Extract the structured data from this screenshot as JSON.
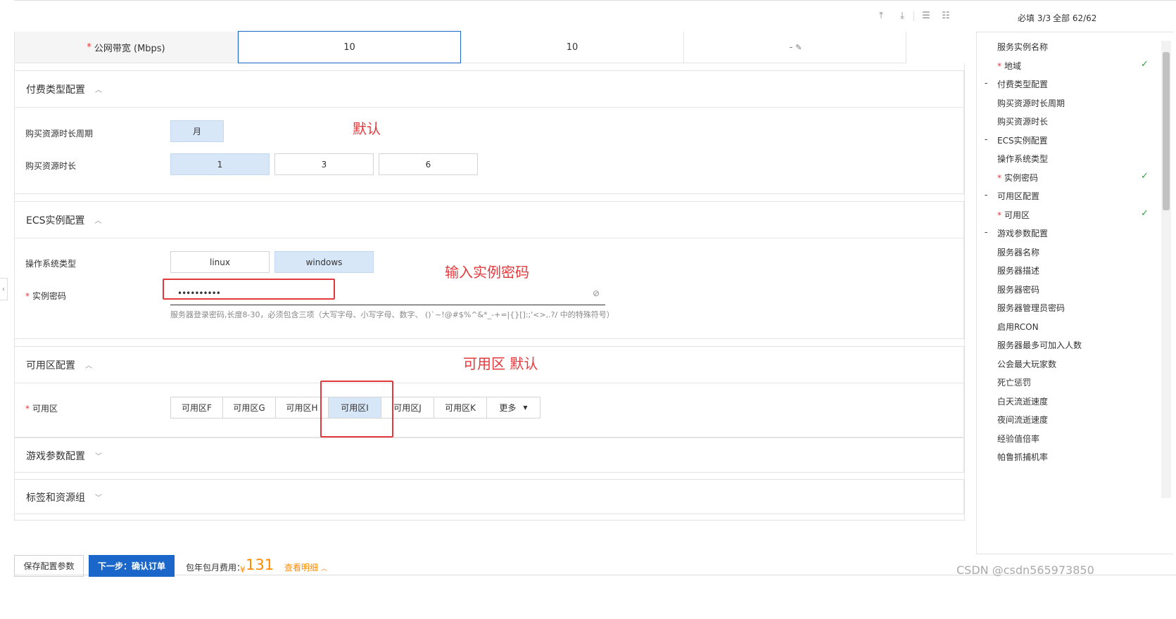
{
  "toolbar": {
    "required_count": "必填 3/3",
    "total_count": "全部 62/62"
  },
  "bandwidth": {
    "label": "公网带宽 (Mbps)",
    "input_value": "10",
    "col2": "10",
    "col3": "-"
  },
  "billing": {
    "title": "付费类型配置",
    "period_label": "购买资源时长周期",
    "period_options": [
      "月"
    ],
    "duration_label": "购买资源时长",
    "duration_options": [
      "1",
      "3",
      "6"
    ]
  },
  "ecs": {
    "title": "ECS实例配置",
    "os_label": "操作系统类型",
    "os_options": [
      "linux",
      "windows"
    ],
    "password_label": "实例密码",
    "password_value": "••••••••••",
    "password_hint": "服务器登录密码,长度8-30，必须包含三项（大写字母、小写字母、数字、 ()`~!@#$%^&*_-+=|{}[]:;'<>,.?/ 中的特殊符号）"
  },
  "zone": {
    "title": "可用区配置",
    "label": "可用区",
    "options": [
      "可用区F",
      "可用区G",
      "可用区H",
      "可用区I",
      "可用区J",
      "可用区K",
      "更多"
    ]
  },
  "collapsed_sections": [
    "游戏参数配置",
    "标签和资源组"
  ],
  "annotations": {
    "default": "默认",
    "password": "输入实例密码",
    "zone_default": "可用区 默认"
  },
  "nav": {
    "items": [
      {
        "label": "服务实例名称"
      },
      {
        "label": "地域",
        "required": true,
        "check": true
      },
      {
        "label": "付费类型配置",
        "group": true
      },
      {
        "label": "购买资源时长周期"
      },
      {
        "label": "购买资源时长"
      },
      {
        "label": "ECS实例配置",
        "group": true
      },
      {
        "label": "操作系统类型"
      },
      {
        "label": "实例密码",
        "required": true,
        "check": true
      },
      {
        "label": "可用区配置",
        "group": true
      },
      {
        "label": "可用区",
        "required": true,
        "check": true
      },
      {
        "label": "游戏参数配置",
        "group": true
      },
      {
        "label": "服务器名称"
      },
      {
        "label": "服务器描述"
      },
      {
        "label": "服务器密码"
      },
      {
        "label": "服务器管理员密码"
      },
      {
        "label": "启用RCON"
      },
      {
        "label": "服务器最多可加入人数"
      },
      {
        "label": "公会最大玩家数"
      },
      {
        "label": "死亡惩罚"
      },
      {
        "label": "白天流逝速度"
      },
      {
        "label": "夜间流逝速度"
      },
      {
        "label": "经验值倍率"
      },
      {
        "label": "帕鲁抓捕机率"
      }
    ]
  },
  "footer": {
    "save_label": "保存配置参数",
    "next_label": "下一步：确认订单",
    "fee_label": "包年包月费用：",
    "currency": "¥",
    "price": "131",
    "detail_label": "查看明细"
  },
  "watermark": "CSDN @csdn565973850",
  "colors": {
    "accent": "#1b66c9",
    "selected_bg": "#d8e7f8",
    "price": "#ff8a00",
    "annotation": "#e4393c",
    "check": "#2ea43d"
  }
}
